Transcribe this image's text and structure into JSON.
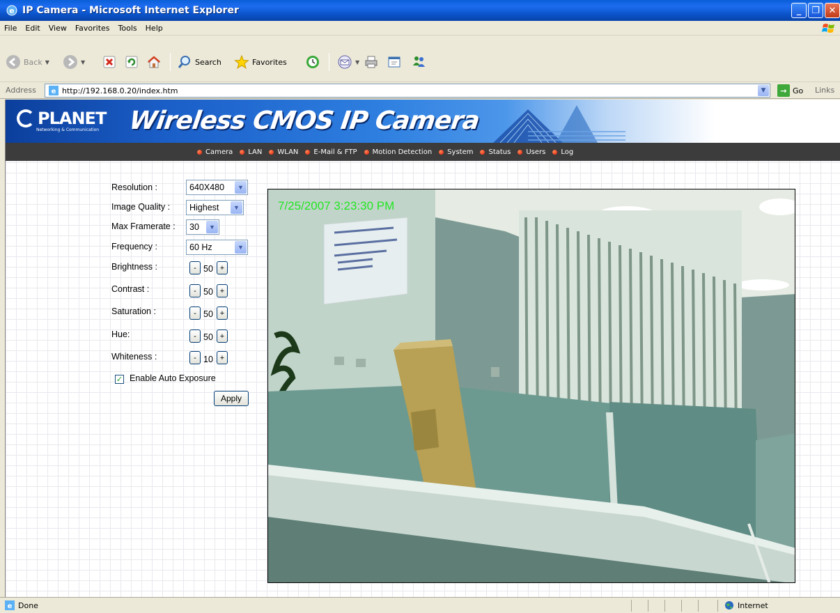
{
  "window": {
    "title": "IP Camera - Microsoft Internet Explorer"
  },
  "menu": [
    "File",
    "Edit",
    "View",
    "Favorites",
    "Tools",
    "Help"
  ],
  "toolbar": {
    "back": "Back",
    "search": "Search",
    "favorites": "Favorites"
  },
  "address": {
    "label": "Address",
    "url": "http://192.168.0.20/index.htm",
    "go": "Go",
    "links": "Links"
  },
  "banner": {
    "logo": "PLANET",
    "logo_sub": "Networking & Communication",
    "title": "Wireless CMOS IP Camera"
  },
  "nav": [
    "Camera",
    "LAN",
    "WLAN",
    "E-Mail & FTP",
    "Motion Detection",
    "System",
    "Status",
    "Users",
    "Log"
  ],
  "settings": {
    "resolution": {
      "label": "Resolution :",
      "value": "640X480"
    },
    "image_quality": {
      "label": "Image Quality :",
      "value": "Highest"
    },
    "max_framerate": {
      "label": "Max Framerate :",
      "value": "30"
    },
    "frequency": {
      "label": "Frequency :",
      "value": "60 Hz"
    },
    "brightness": {
      "label": "Brightness :",
      "value": "50"
    },
    "contrast": {
      "label": "Contrast :",
      "value": "50"
    },
    "saturation": {
      "label": "Saturation :",
      "value": "50"
    },
    "hue": {
      "label": "Hue:",
      "value": "50"
    },
    "whiteness": {
      "label": "Whiteness :",
      "value": "10"
    },
    "minus": "-",
    "plus": "+",
    "auto_exposure": {
      "label": "Enable Auto Exposure",
      "checked": true
    },
    "apply": "Apply"
  },
  "camera": {
    "timestamp": "7/25/2007 3:23:30 PM"
  },
  "status": {
    "text": "Done",
    "zone": "Internet"
  }
}
